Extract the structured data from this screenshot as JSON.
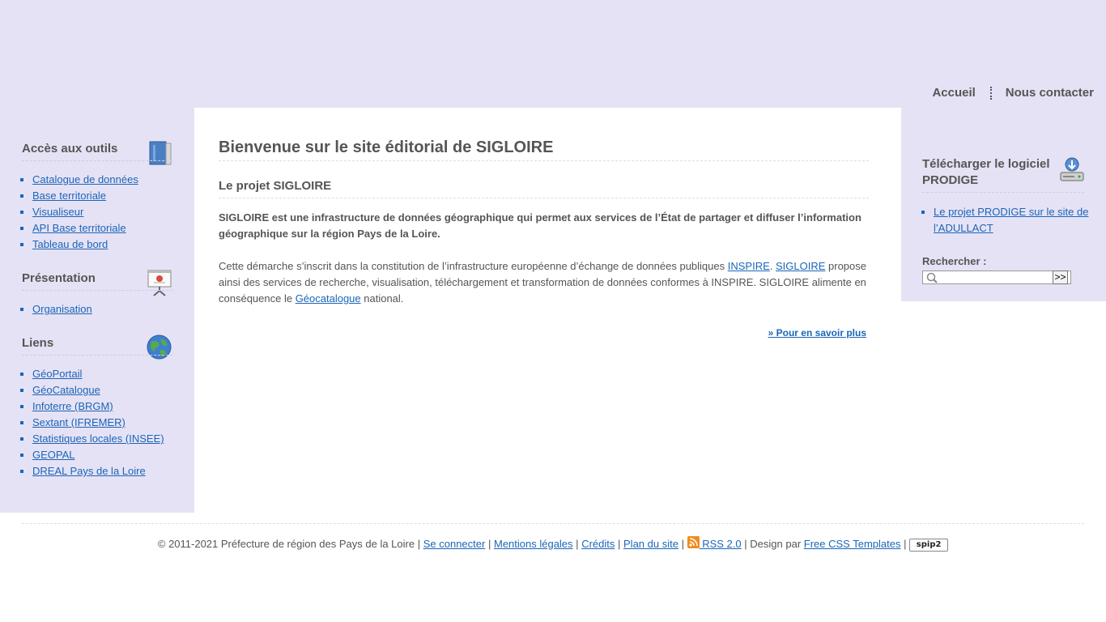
{
  "header": {
    "nav": [
      {
        "label": "Accueil"
      },
      {
        "label": "Nous contacter"
      }
    ]
  },
  "left_sidebar": {
    "tools": {
      "title": "Accès aux outils",
      "icon": "book-icon",
      "items": [
        "Catalogue de données",
        "Base territoriale",
        "Visualiseur",
        "API Base territoriale",
        "Tableau de bord"
      ]
    },
    "presentation": {
      "title": "Présentation",
      "icon": "presentation-board-icon",
      "items": [
        "Organisation"
      ]
    },
    "links": {
      "title": "Liens",
      "icon": "globe-icon",
      "items": [
        "GéoPortail",
        "GéoCatalogue",
        "Infoterre (BRGM)",
        "Sextant (IFREMER)",
        "Statistiques locales (INSEE)",
        "GEOPAL",
        "DREAL Pays de la Loire"
      ]
    }
  },
  "main": {
    "title": "Bienvenue sur le site éditorial de SIGLOIRE",
    "subtitle": "Le projet SIGLOIRE",
    "intro": "SIGLOIRE est une infrastructure de données géographique qui permet aux services de l’État de partager et diffuser l’information géographique sur la région Pays de la Loire.",
    "para": {
      "text1": "Cette démarche s’inscrit dans la constitution de l’infrastructure européenne d’échange de données publiques ",
      "link1": "INSPIRE",
      "sep": ". ",
      "link2": "SIGLOIRE",
      "text2": " propose ainsi des services de recherche, visualisation, téléchargement et transformation de données conformes à INSPIRE. SIGLOIRE alimente en conséquence le ",
      "link3": "Géocatalogue",
      "text3": " national."
    },
    "more_link": "» Pour en savoir plus"
  },
  "right_sidebar": {
    "download_title": "Télécharger le logiciel PRODIGE",
    "download_icon": "download-drive-icon",
    "download_link": "Le projet PRODIGE sur le site de l’ADULLACT",
    "search_label": "Rechercher :",
    "search_value": "",
    "search_button": ">>"
  },
  "footer": {
    "copyright": "© 2011-2021 Préfecture de région des Pays de la Loire",
    "pipe": "|",
    "login": "Se connecter",
    "legal": "Mentions légales",
    "credits": "Crédits",
    "sitemap": "Plan du site",
    "rss": "RSS 2.0",
    "design_by": "Design par",
    "design_link": "Free CSS Templates",
    "spip_logo_text": "spip2"
  },
  "colors": {
    "band": "#e6e2f5",
    "link": "#1a66b8",
    "text": "#555555"
  }
}
